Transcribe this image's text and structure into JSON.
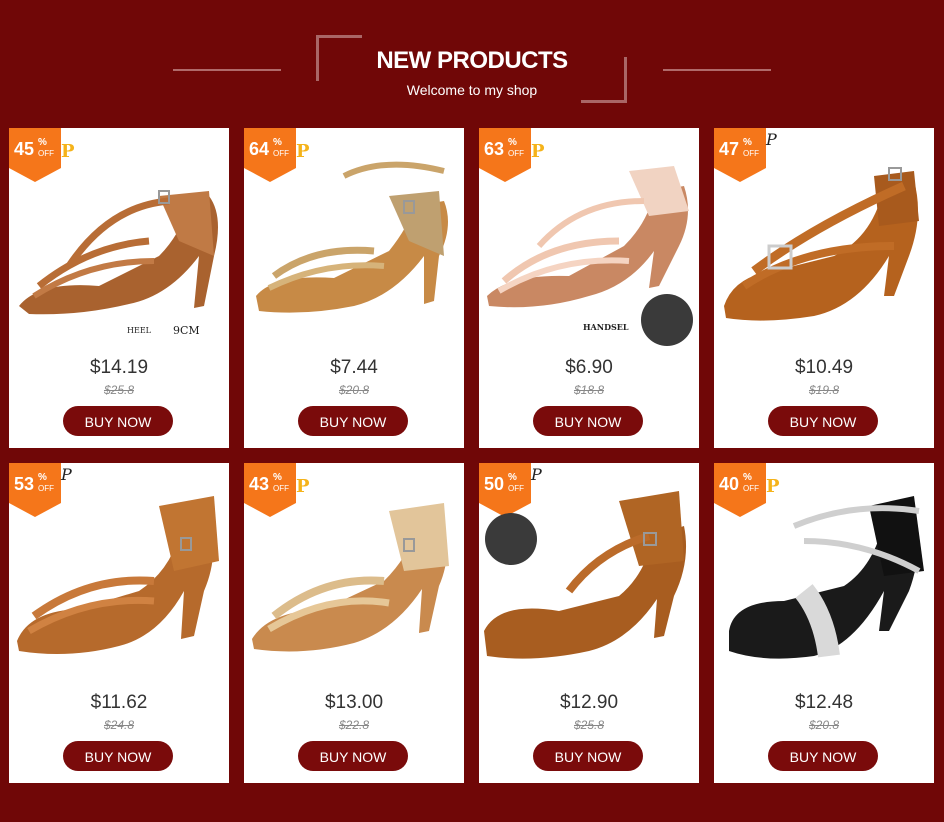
{
  "header": {
    "title": "NEW PRODUCTS",
    "subtitle": "Welcome to my shop"
  },
  "colors": {
    "background": "#700707",
    "badge": "#f5761a",
    "button": "#7a0b0b"
  },
  "products": [
    {
      "discount": "45",
      "percent_sign": "%",
      "off_label": "OFF",
      "price": "$14.19",
      "old_price": "$25.8",
      "button": "BUY NOW",
      "note": "HEEL",
      "note_value": "9CM",
      "shoe": "tan-satin"
    },
    {
      "discount": "64",
      "percent_sign": "%",
      "off_label": "OFF",
      "price": "$7.44",
      "old_price": "$20.8",
      "button": "BUY NOW",
      "shoe": "gold-satin"
    },
    {
      "discount": "63",
      "percent_sign": "%",
      "off_label": "OFF",
      "price": "$6.90",
      "old_price": "$18.8",
      "button": "BUY NOW",
      "note": "HANDSEL",
      "shoe": "pink-satin"
    },
    {
      "discount": "47",
      "percent_sign": "%",
      "off_label": "OFF",
      "price": "$10.49",
      "old_price": "$19.8",
      "button": "BUY NOW",
      "shoe": "bronze-buckle"
    },
    {
      "discount": "53",
      "percent_sign": "%",
      "off_label": "OFF",
      "price": "$11.62",
      "old_price": "$24.8",
      "button": "BUY NOW",
      "shoe": "tan-satin"
    },
    {
      "discount": "43",
      "percent_sign": "%",
      "off_label": "OFF",
      "price": "$13.00",
      "old_price": "$22.8",
      "button": "BUY NOW",
      "shoe": "gold-satin"
    },
    {
      "discount": "50",
      "percent_sign": "%",
      "off_label": "OFF",
      "price": "$12.90",
      "old_price": "$25.8",
      "button": "BUY NOW",
      "shoe": "bronze-rhinestone"
    },
    {
      "discount": "40",
      "percent_sign": "%",
      "off_label": "OFF",
      "price": "$12.48",
      "old_price": "$20.8",
      "button": "BUY NOW",
      "shoe": "black-silver"
    }
  ]
}
